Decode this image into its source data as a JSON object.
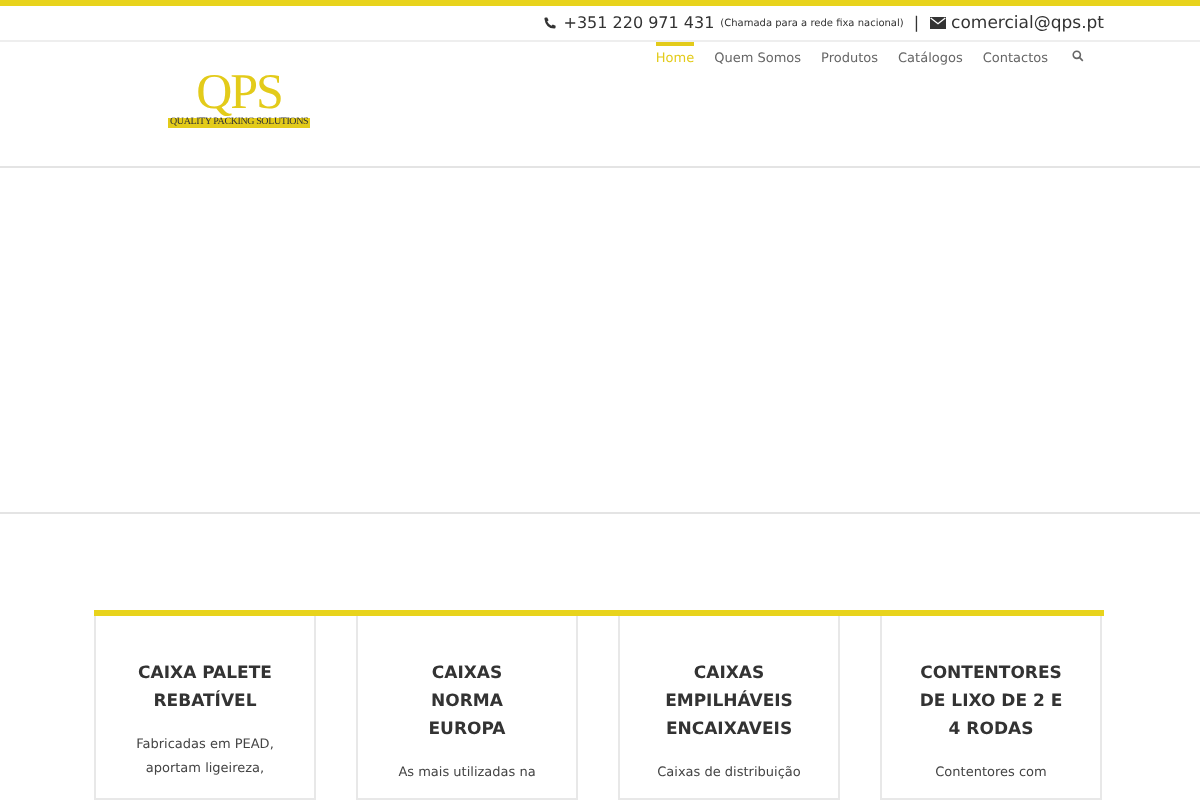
{
  "top_bar": {
    "phone": "+351 220 971 431",
    "phone_note": "(Chamada para a rede fixa nacional)",
    "separator": "|",
    "email": "comercial@qps.pt"
  },
  "logo": {
    "letters": "QPS",
    "tagline": "QUALITY PACKING SOLUTIONS"
  },
  "nav": [
    {
      "label": "Home",
      "selected": true
    },
    {
      "label": "Quem Somos",
      "selected": false
    },
    {
      "label": "Produtos",
      "selected": false
    },
    {
      "label": "Catálogos",
      "selected": false
    },
    {
      "label": "Contactos",
      "selected": false
    }
  ],
  "cards": [
    {
      "title": "CAIXA PALETE REBATÍVEL",
      "text": "Fabricadas em PEAD, aportam ligeireza,"
    },
    {
      "title": "CAIXAS NORMA EUROPA",
      "text": "As mais utilizadas na"
    },
    {
      "title": "CAIXAS EMPILHÁVEIS ENCAIXAVEIS",
      "text": "Caixas de distribuição"
    },
    {
      "title": "CONTENTORES DE LIXO DE 2 E 4 RODAS",
      "text": "Contentores com"
    }
  ]
}
